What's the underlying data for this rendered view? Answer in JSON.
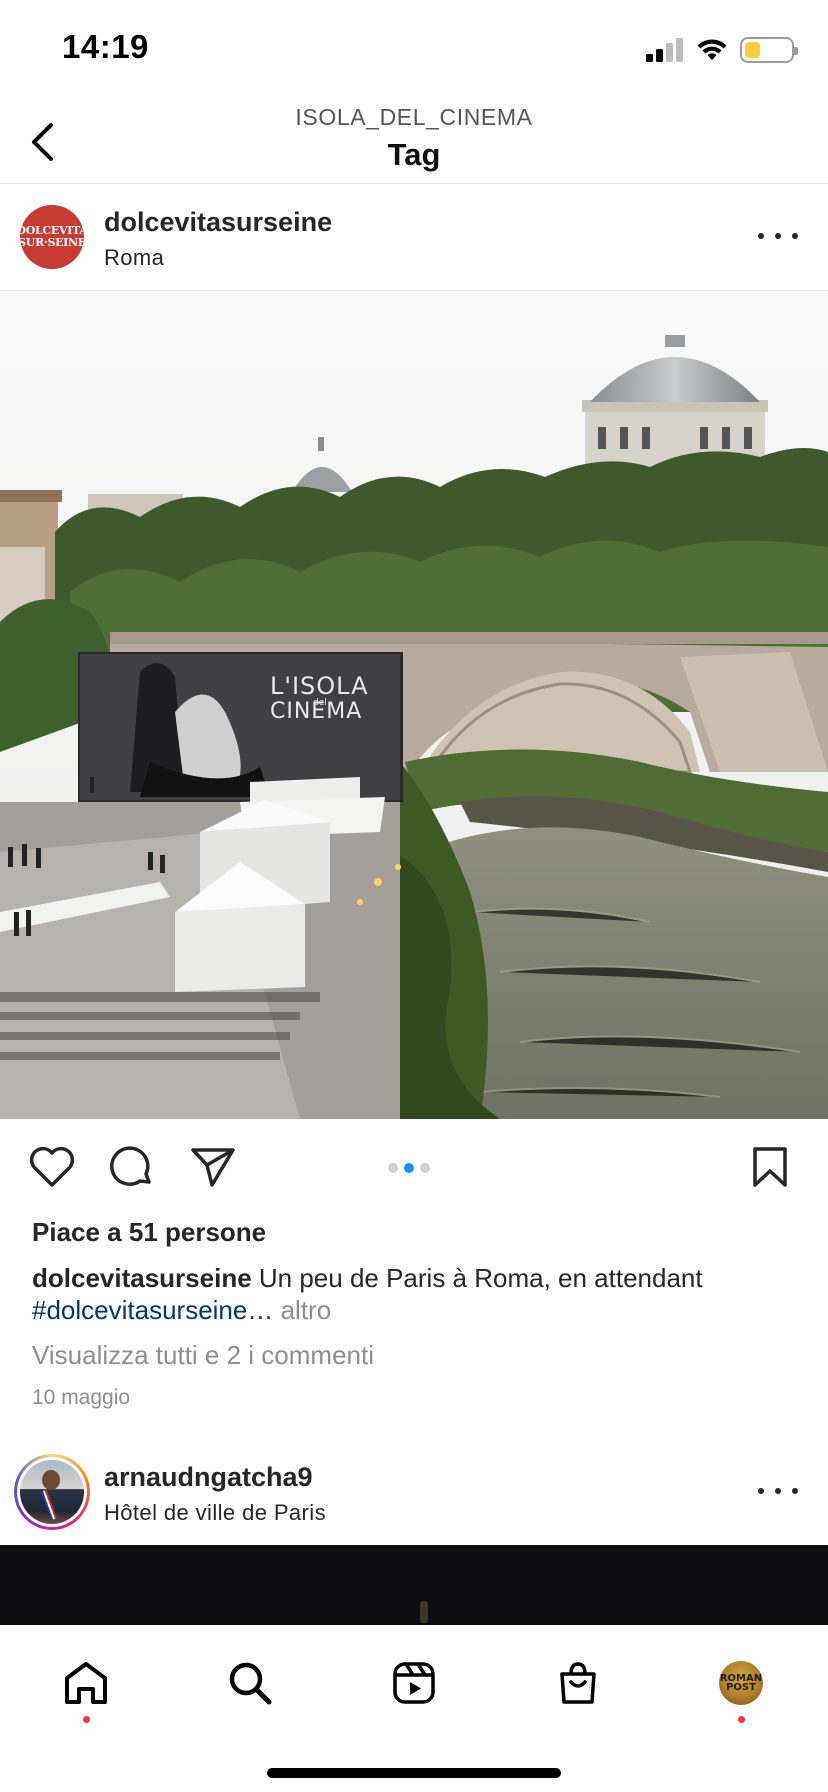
{
  "status_bar": {
    "time": "14:19",
    "battery_level": 0.35,
    "battery_color": "#f7cf3d"
  },
  "header": {
    "subtitle": "ISOLA_DEL_CINEMA",
    "title": "Tag"
  },
  "post1": {
    "username": "dolcevitasurseine",
    "location": "Roma",
    "avatar_text": [
      "DOLCEVITA",
      "SUR·SEINE"
    ],
    "avatar_color": "#c73b34",
    "photo": {
      "banner_line1": "L'ISOLA",
      "banner_line2": "CINEMA",
      "banner_small": "del"
    },
    "carousel": {
      "count": 3,
      "active_index": 1
    },
    "likes": "Piace a 51 persone",
    "caption_user": "dolcevitasurseine",
    "caption_text": " Un peu de Paris à Roma, en attendant ",
    "caption_hashtag": "#dolcevitasurseine",
    "caption_ellipsis": "…",
    "caption_more": " altro",
    "comments_link": "Visualizza tutti e 2 i commenti",
    "date": "10 maggio"
  },
  "post2": {
    "username": "arnaudngatcha9",
    "location": "Hôtel de ville de Paris"
  },
  "tab_bar": {
    "tabs": [
      "home-icon",
      "search-icon",
      "reels-icon",
      "shop-icon",
      "profile"
    ],
    "profile_text": [
      "ROMAN",
      "POST"
    ],
    "notification_color": "#ff3040"
  },
  "colors": {
    "hashtag": "#00376b",
    "muted": "#8e8e8e",
    "carousel_active": "#1e90ff"
  }
}
